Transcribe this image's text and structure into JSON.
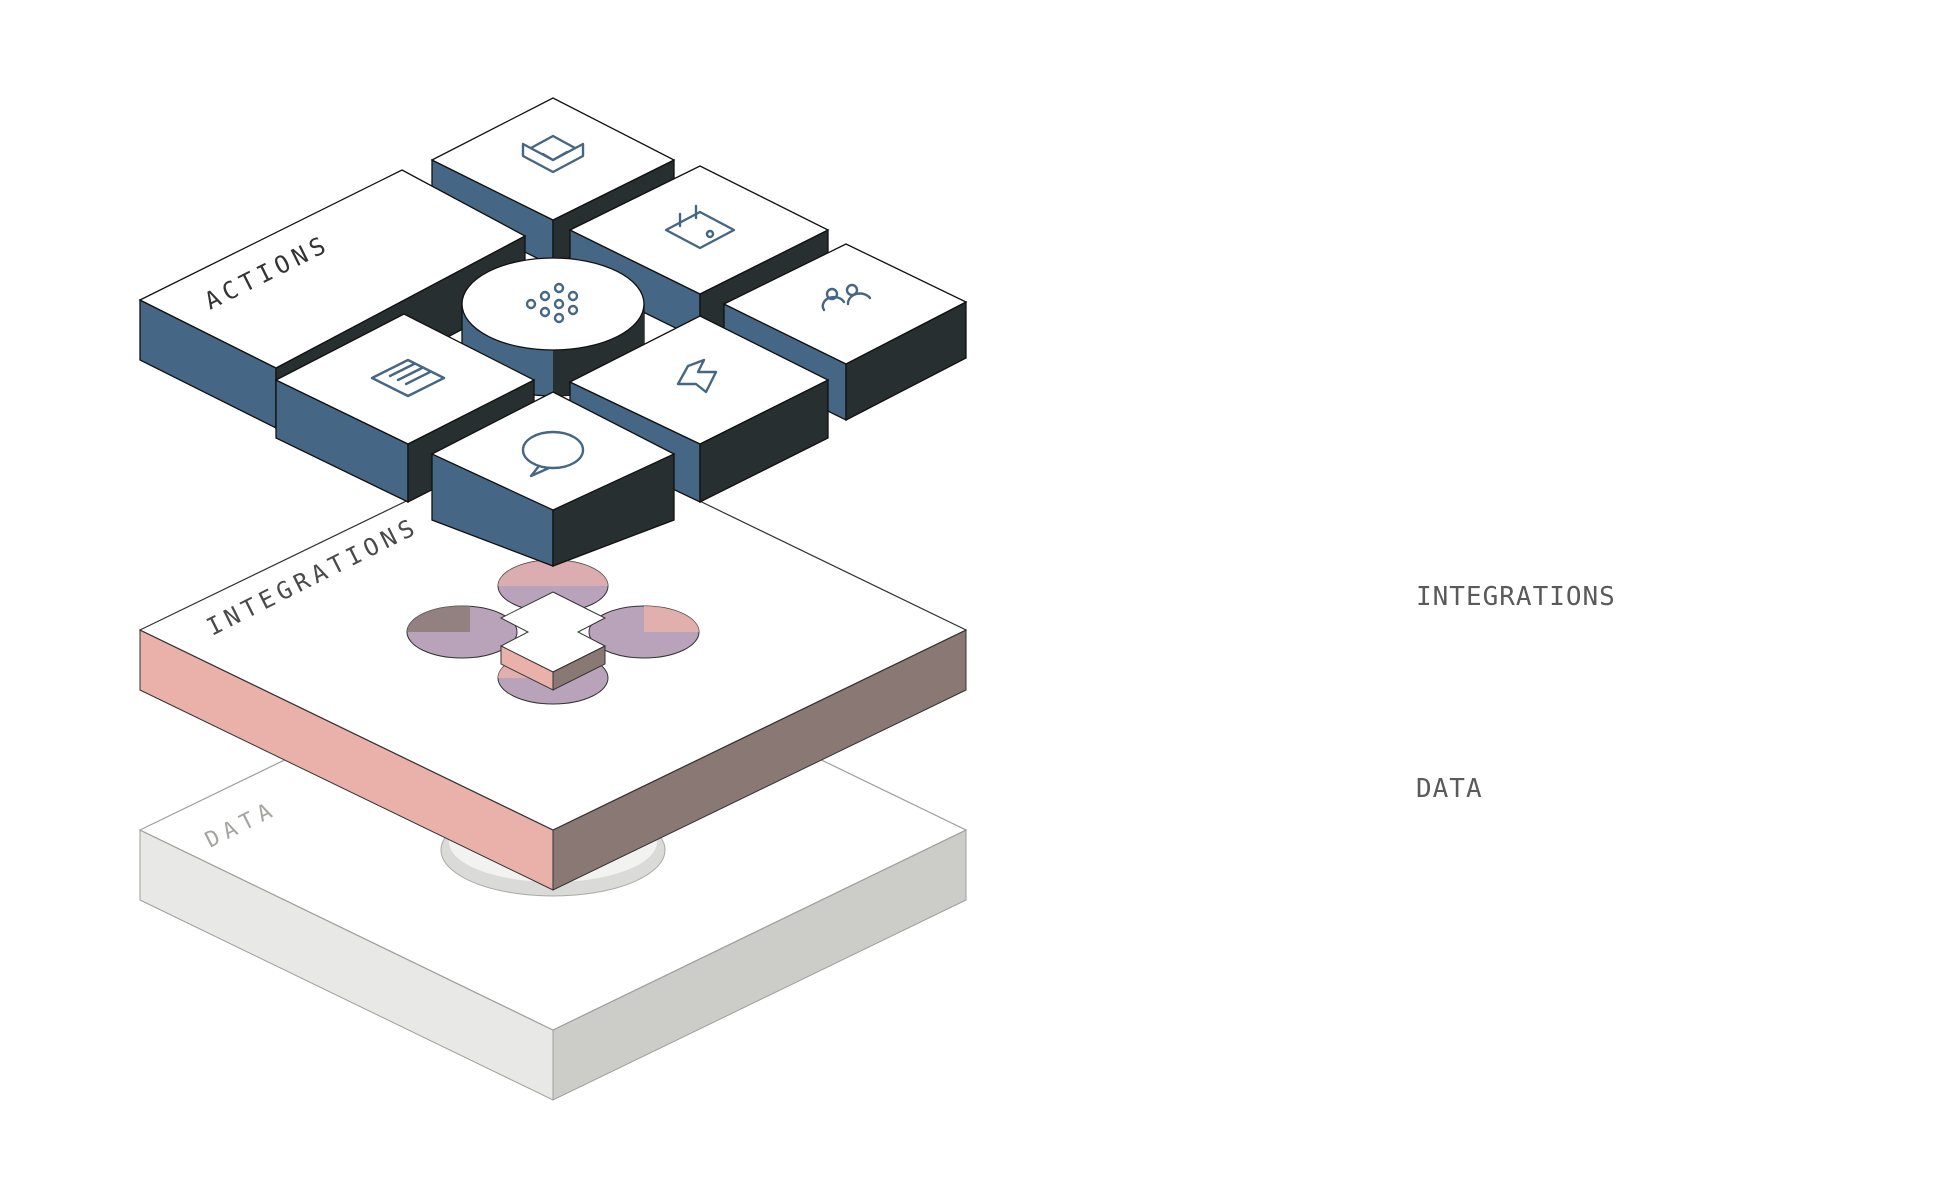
{
  "layers": {
    "actions": {
      "label": "ACTIONS",
      "tiles": [
        {
          "name": "mail-inbox-icon"
        },
        {
          "name": "calendar-wallet-icon"
        },
        {
          "name": "people-group-icon"
        },
        {
          "name": "apps-grid-icon"
        },
        {
          "name": "notes-list-icon"
        },
        {
          "name": "lightning-bolt-icon"
        },
        {
          "name": "chat-bubble-icon"
        }
      ]
    },
    "integrations": {
      "label": "INTEGRATIONS"
    },
    "data": {
      "label": "DATA"
    }
  },
  "legend": {
    "integrations": "INTEGRATIONS",
    "data": "DATA"
  },
  "colors": {
    "actions_side_light": "#456684",
    "actions_side_dark": "#272f31",
    "integrations_side_light": "#eab1ab",
    "integrations_side_dark": "#8a7874",
    "hole_fill": "#b9a3bb",
    "data_side_light": "#e7e7e5",
    "data_side_dark": "#cacac7",
    "icon_stroke": "#456684"
  }
}
